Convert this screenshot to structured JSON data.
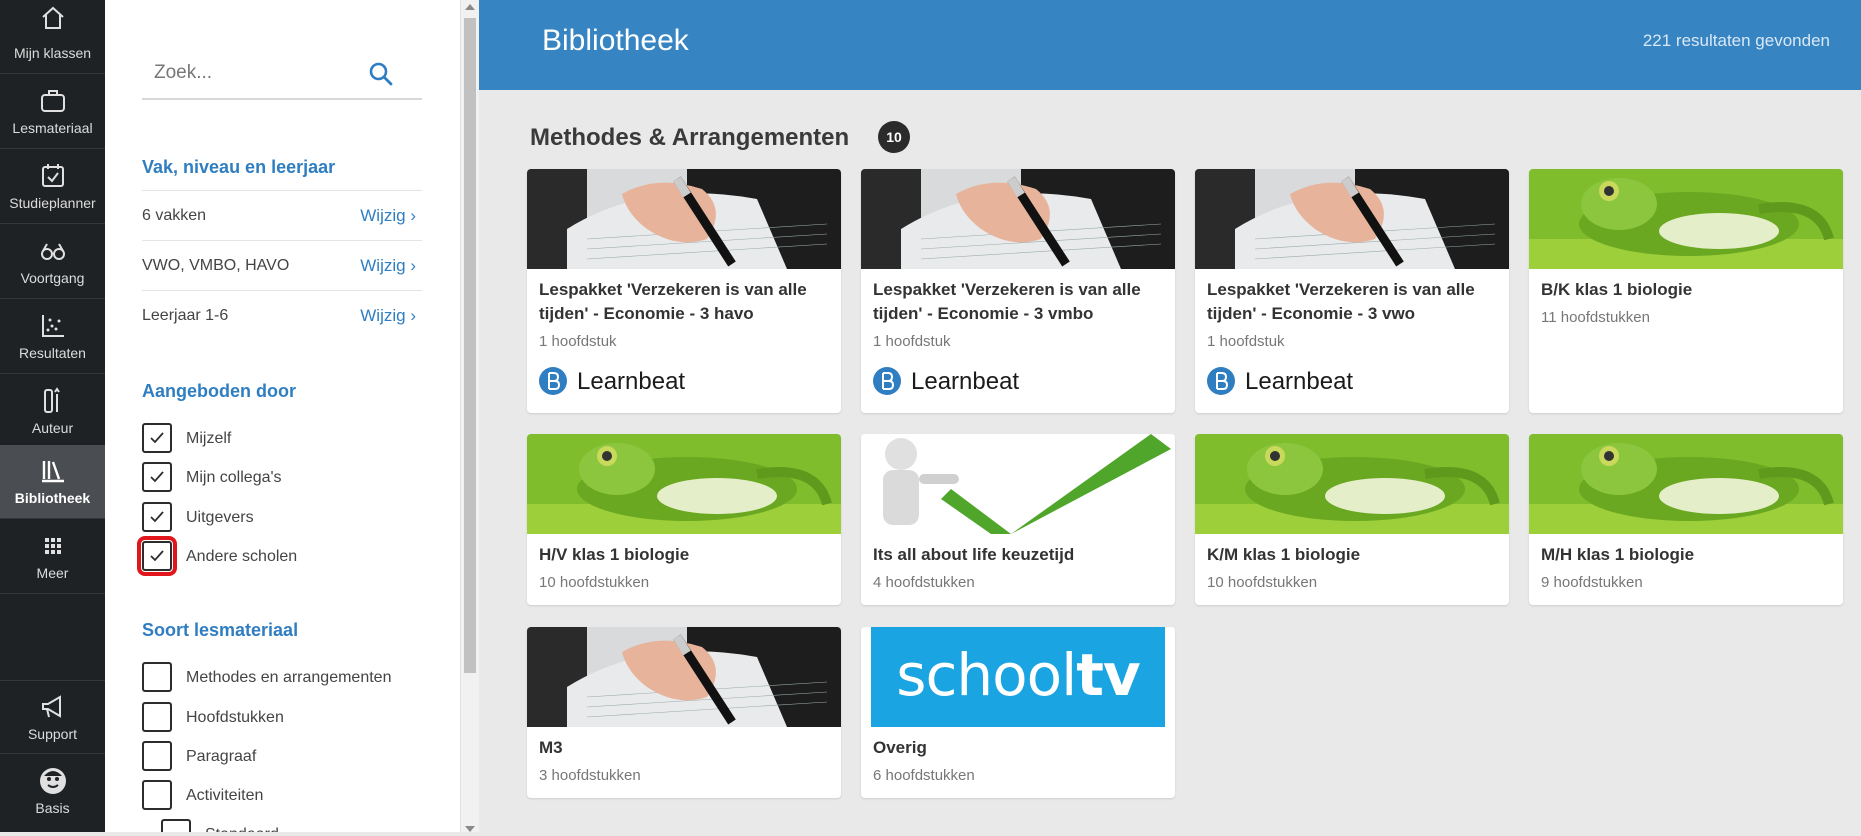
{
  "nav": {
    "items": [
      {
        "label": "Mijn klassen",
        "icon": "home-icon"
      },
      {
        "label": "Lesmateriaal",
        "icon": "briefcase-icon"
      },
      {
        "label": "Studieplanner",
        "icon": "calendar-check-icon"
      },
      {
        "label": "Voortgang",
        "icon": "glasses-icon"
      },
      {
        "label": "Resultaten",
        "icon": "scatter-chart-icon"
      },
      {
        "label": "Auteur",
        "icon": "author-icon"
      },
      {
        "label": "Bibliotheek",
        "icon": "library-icon",
        "active": true
      },
      {
        "label": "Meer",
        "icon": "grid-icon"
      },
      {
        "label": "Support",
        "icon": "megaphone-icon"
      },
      {
        "label": "Basis",
        "icon": "avatar-icon"
      }
    ]
  },
  "search": {
    "placeholder": "Zoek..."
  },
  "filters": {
    "section1_title": "Vak, niveau en leerjaar",
    "rows": [
      {
        "text": "6 vakken",
        "link": "Wijzig"
      },
      {
        "text": "VWO, VMBO, HAVO",
        "link": "Wijzig"
      },
      {
        "text": "Leerjaar 1-6",
        "link": "Wijzig"
      }
    ],
    "section2_title": "Aangeboden door",
    "offered_by": [
      {
        "label": "Mijzelf",
        "checked": true
      },
      {
        "label": "Mijn collega's",
        "checked": true
      },
      {
        "label": "Uitgevers",
        "checked": true
      },
      {
        "label": "Andere scholen",
        "checked": true
      }
    ],
    "section3_title": "Soort lesmateriaal",
    "material_types": [
      {
        "label": "Methodes en arrangementen",
        "checked": false
      },
      {
        "label": "Hoofdstukken",
        "checked": false
      },
      {
        "label": "Paragraaf",
        "checked": false
      },
      {
        "label": "Activiteiten",
        "checked": false
      },
      {
        "label": "Standaard",
        "checked": false
      }
    ]
  },
  "header": {
    "title": "Bibliotheek",
    "result_count": "221 resultaten gevonden"
  },
  "section": {
    "title": "Methodes & Arrangementen",
    "count": "10"
  },
  "cards": [
    {
      "title": "Lespakket 'Verzekeren is van alle tijden' - Economie - 3 havo",
      "subtitle": "1 hoofdstuk",
      "image": "pen-writing",
      "publisher": "Learnbeat"
    },
    {
      "title": "Lespakket 'Verzekeren is van alle tijden' - Economie - 3 vmbo",
      "subtitle": "1 hoofdstuk",
      "image": "pen-writing",
      "publisher": "Learnbeat"
    },
    {
      "title": "Lespakket 'Verzekeren is van alle tijden' - Economie - 3 vwo",
      "subtitle": "1 hoofdstuk",
      "image": "pen-writing",
      "publisher": "Learnbeat"
    },
    {
      "title": "B/K klas 1 biologie",
      "subtitle": "11 hoofdstukken",
      "image": "frog"
    },
    {
      "title": "H/V klas 1 biologie",
      "subtitle": "10 hoofdstukken",
      "image": "frog"
    },
    {
      "title": "Its all about life keuzetijd",
      "subtitle": "4 hoofdstukken",
      "image": "checkmark-figure"
    },
    {
      "title": "K/M klas 1 biologie",
      "subtitle": "10 hoofdstukken",
      "image": "frog"
    },
    {
      "title": "M/H klas 1 biologie",
      "subtitle": "9 hoofdstukken",
      "image": "frog"
    },
    {
      "title": "M3",
      "subtitle": "3 hoofdstukken",
      "image": "pen-writing"
    },
    {
      "title": "Overig",
      "subtitle": "6 hoofdstukken",
      "image": "schooltv",
      "image_text_light": "school",
      "image_text_bold": "tv"
    }
  ],
  "colors": {
    "accent": "#3784c3",
    "link": "#2f7ec2",
    "nav_bg": "#1f2225",
    "highlight": "#e0161c"
  }
}
